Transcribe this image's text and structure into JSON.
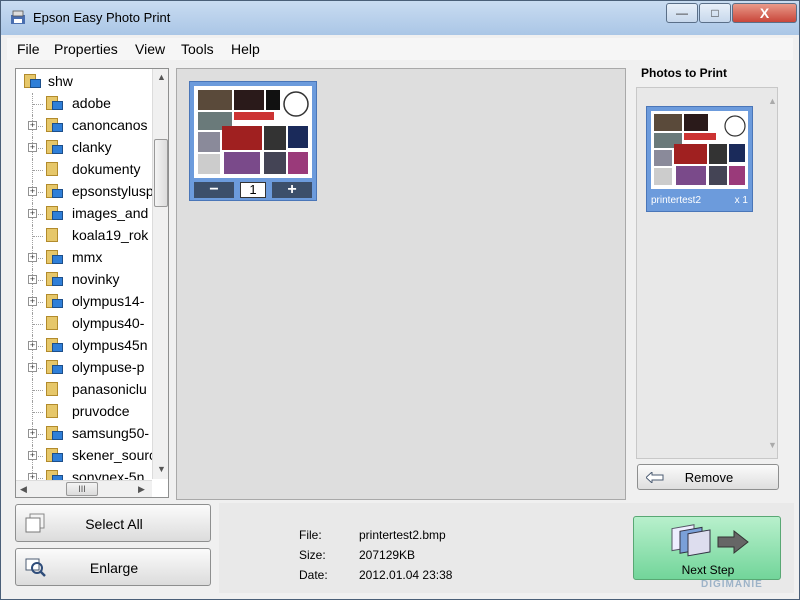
{
  "window": {
    "title": "Epson Easy Photo Print",
    "controls": {
      "minimize": "—",
      "maximize": "□",
      "close": "X"
    }
  },
  "menu": [
    "File",
    "Properties",
    "View",
    "Tools",
    "Help"
  ],
  "tree": {
    "root": "shw",
    "items": [
      {
        "label": "adobe",
        "expandable": false
      },
      {
        "label": "canoncanos",
        "expandable": true
      },
      {
        "label": "clanky",
        "expandable": true
      },
      {
        "label": "dokumenty",
        "expandable": false
      },
      {
        "label": "epsonstylusp",
        "expandable": true
      },
      {
        "label": "images_and",
        "expandable": true
      },
      {
        "label": "koala19_rok",
        "expandable": false
      },
      {
        "label": "mmx",
        "expandable": true
      },
      {
        "label": "novinky",
        "expandable": true
      },
      {
        "label": "olympus14-",
        "expandable": true
      },
      {
        "label": "olympus40-",
        "expandable": false
      },
      {
        "label": "olympus45n",
        "expandable": true
      },
      {
        "label": "olympuse-p",
        "expandable": true
      },
      {
        "label": "panasoniclu",
        "expandable": false
      },
      {
        "label": "pruvodce",
        "expandable": false
      },
      {
        "label": "samsung50-",
        "expandable": true
      },
      {
        "label": "skener_sourc",
        "expandable": true
      },
      {
        "label": "sonynex-5n",
        "expandable": true
      }
    ],
    "hscroll_thumb": "III"
  },
  "thumbnail": {
    "quantity": "1",
    "minus": "−",
    "plus": "+"
  },
  "photos_to_print": {
    "title": "Photos to Print",
    "items": [
      {
        "name": "printertest2",
        "count": "x 1"
      }
    ]
  },
  "buttons": {
    "remove": "Remove",
    "select_all": "Select All",
    "enlarge": "Enlarge",
    "next_step": "Next Step"
  },
  "file_info": {
    "file_label": "File:",
    "file_value": "printertest2.bmp",
    "size_label": "Size:",
    "size_value": "207129KB",
    "date_label": "Date:",
    "date_value": "2012.01.04 23:38"
  },
  "watermark": "DIGIMANIE",
  "colors": {
    "selection": "#6c9bdc",
    "next_step": "#8ee2ad",
    "titlebar": "#bcd3ea"
  }
}
